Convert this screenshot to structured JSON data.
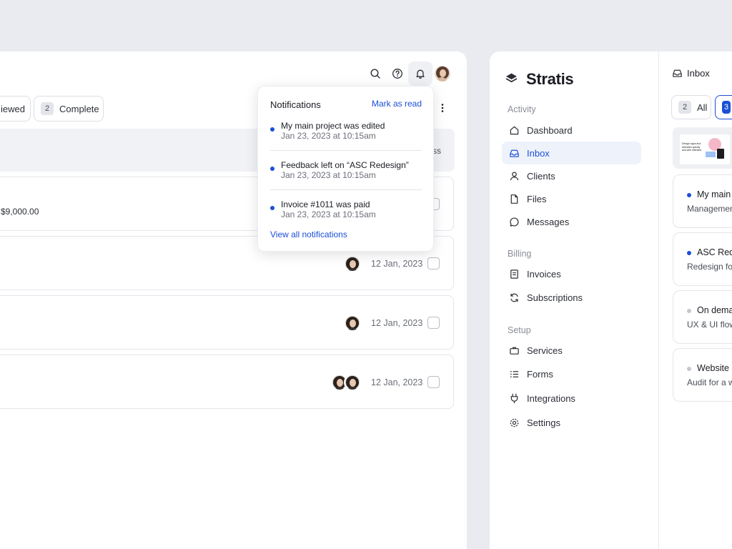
{
  "left": {
    "chips": [
      {
        "label": "iewed"
      },
      {
        "count": "2",
        "label": "Complete"
      }
    ],
    "header_partial": "ss",
    "rows": [
      {
        "amount": "$9,000.00"
      },
      {
        "date": "12 Jan, 2023"
      },
      {
        "date": "12 Jan, 2023"
      },
      {
        "date": "12 Jan, 2023"
      }
    ]
  },
  "notifications": {
    "title": "Notifications",
    "mark_read": "Mark as read",
    "items": [
      {
        "title": "My main project was edited",
        "time": "Jan 23, 2023 at 10:15am"
      },
      {
        "title": "Feedback left on “ASC Redesign”",
        "time": "Jan 23, 2023 at 10:15am"
      },
      {
        "title": "Invoice #1011 was paid",
        "time": "Jan 23, 2023 at 10:15am"
      }
    ],
    "view_all": "View all notifications"
  },
  "sidebar": {
    "brand": "Stratis",
    "sections": [
      {
        "title": "Activity",
        "items": [
          "Dashboard",
          "Inbox",
          "Clients",
          "Files",
          "Messages"
        ]
      },
      {
        "title": "Billing",
        "items": [
          "Invoices",
          "Subscriptions"
        ]
      },
      {
        "title": "Setup",
        "items": [
          "Services",
          "Forms",
          "Integrations",
          "Settings"
        ]
      }
    ],
    "active_item": "Inbox"
  },
  "inbox": {
    "title": "Inbox",
    "tabs": [
      {
        "count": "2",
        "label": "All"
      },
      {
        "count": "3",
        "label": ""
      }
    ],
    "cards": [
      {
        "title": "My main",
        "subtitle": "Managemen",
        "unread": true
      },
      {
        "title": "ASC Red",
        "subtitle": "Redesign fo",
        "unread": true
      },
      {
        "title": "On dema",
        "subtitle": "UX & UI flow",
        "unread": false
      },
      {
        "title": "Website",
        "subtitle": "Audit for a w",
        "unread": false
      }
    ],
    "thumbnail_text": "Design apps and websites quickly and with intention."
  },
  "colors": {
    "accent": "#1c4fd6",
    "read_dot": "#c4c7ce"
  }
}
